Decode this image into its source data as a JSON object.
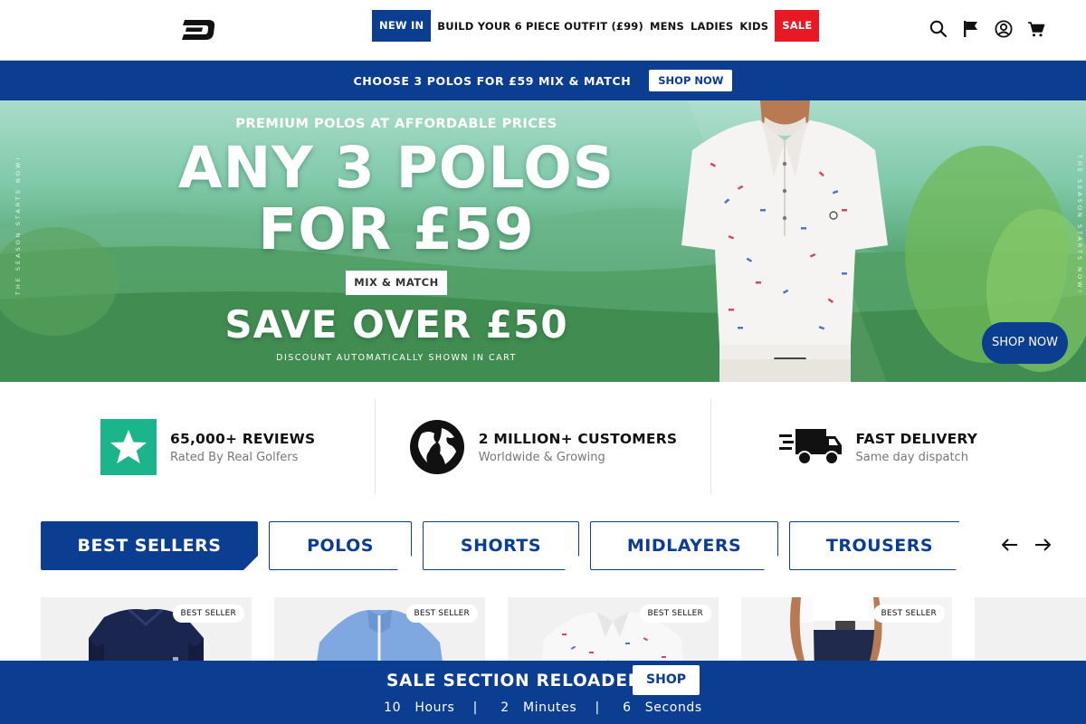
{
  "header": {
    "logo_alt": "brand-logo",
    "nav": [
      {
        "label": "NEW IN",
        "style": "new"
      },
      {
        "label": "BUILD YOUR 6 PIECE OUTFIT (£99)",
        "style": "plain"
      },
      {
        "label": "MENS",
        "style": "plain"
      },
      {
        "label": "LADIES",
        "style": "plain"
      },
      {
        "label": "KIDS",
        "style": "plain"
      },
      {
        "label": "SALE",
        "style": "sale"
      }
    ],
    "icons": [
      "search-icon",
      "flag-icon",
      "account-icon",
      "cart-icon"
    ]
  },
  "promo": {
    "text": "CHOOSE 3 POLOS FOR £59 MIX & MATCH",
    "button": "SHOP NOW"
  },
  "hero": {
    "line1": "PREMIUM POLOS AT AFFORDABLE PRICES",
    "line2": "ANY 3 POLOS",
    "line3": "FOR £59",
    "badge": "MIX & MATCH",
    "line4": "SAVE OVER £50",
    "line5": "DISCOUNT AUTOMATICALLY SHOWN IN CART",
    "vertical_text": "THE SEASON STARTS NOW!",
    "shop_button": "SHOP NOW"
  },
  "trust": [
    {
      "title": "65,000+ REVIEWS",
      "subtitle": "Rated By Real Golfers",
      "icon": "star-icon"
    },
    {
      "title": "2 MILLION+ CUSTOMERS",
      "subtitle": "Worldwide & Growing",
      "icon": "globe-icon"
    },
    {
      "title": "FAST DELIVERY",
      "subtitle": "Same day dispatch",
      "icon": "truck-icon"
    }
  ],
  "tabs": [
    "BEST SELLERS",
    "POLOS",
    "SHORTS",
    "MIDLAYERS",
    "TROUSERS"
  ],
  "products": [
    {
      "badge": "BEST SELLER",
      "kind": "gilet"
    },
    {
      "badge": "BEST SELLER",
      "kind": "quarter-zip"
    },
    {
      "badge": "BEST SELLER",
      "kind": "polo"
    },
    {
      "badge": "BEST SELLER",
      "kind": "trousers"
    },
    {
      "badge": "",
      "kind": "empty"
    }
  ],
  "salebar": {
    "title": "SALE SECTION RELOADED",
    "button": "SHOP",
    "countdown": {
      "hours_value": "10",
      "hours_label": "Hours",
      "minutes_value": "2",
      "minutes_label": "Minutes",
      "seconds_value": "6",
      "seconds_label": "Seconds",
      "separator": "|"
    }
  },
  "colors": {
    "brand_blue": "#0b3d91",
    "sale_red": "#e81824",
    "trustpilot_green": "#1cb48a"
  }
}
